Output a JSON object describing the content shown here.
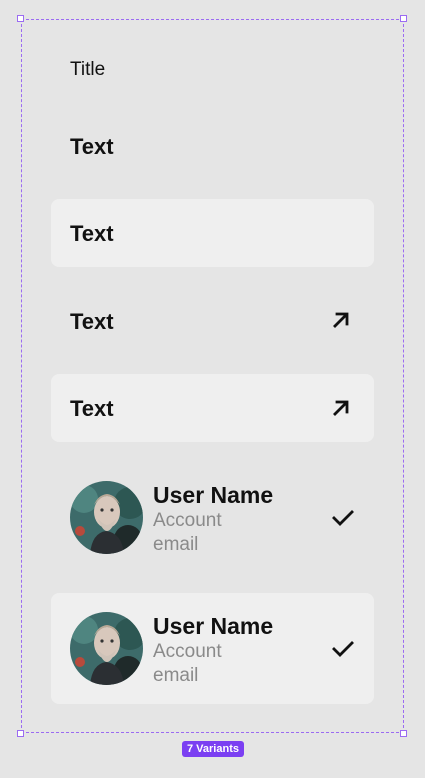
{
  "component_set": {
    "title": "Title",
    "variants_badge": "7 Variants",
    "accent_color": "#9b6bf2",
    "badge_color": "#7b3ff2"
  },
  "variants": [
    {
      "label": "Text",
      "filled": false,
      "icon": null
    },
    {
      "label": "Text",
      "filled": true,
      "icon": null
    },
    {
      "label": "Text",
      "filled": false,
      "icon": "arrow-up-right-icon"
    },
    {
      "label": "Text",
      "filled": true,
      "icon": "arrow-up-right-icon"
    }
  ],
  "user_variants": [
    {
      "name": "User Name",
      "email": "Account email",
      "filled": false,
      "icon": "check-icon"
    },
    {
      "name": "User Name",
      "email": "Account email",
      "filled": true,
      "icon": "check-icon"
    }
  ]
}
